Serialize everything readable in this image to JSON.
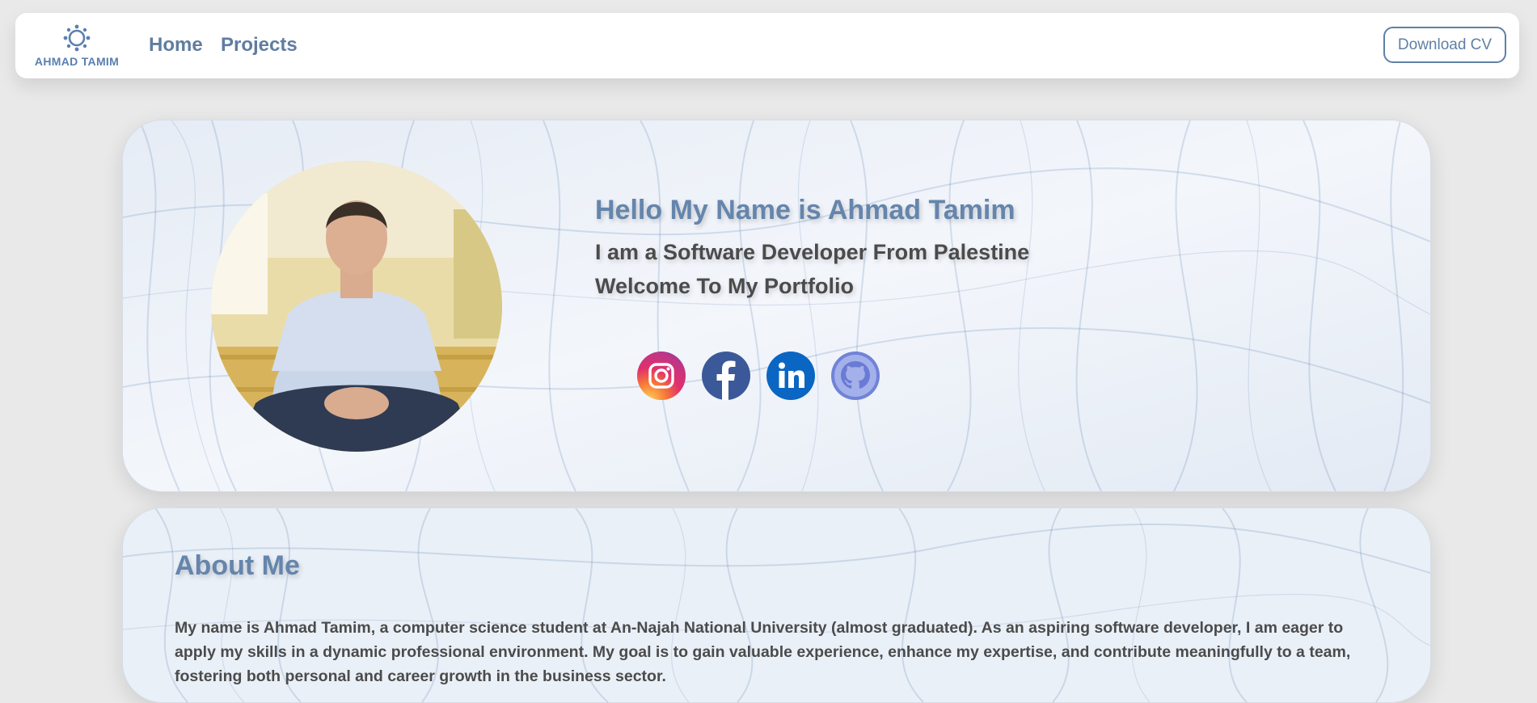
{
  "nav": {
    "logo_text": "AHMAD TAMIM",
    "links": [
      {
        "label": "Home"
      },
      {
        "label": "Projects"
      }
    ],
    "download_label": "Download CV"
  },
  "hero": {
    "title": "Hello My Name is Ahmad Tamim",
    "subtitle_1": "I am a Software Developer From Palestine",
    "subtitle_2": "Welcome To My Portfolio",
    "social": [
      {
        "icon": "instagram-icon"
      },
      {
        "icon": "facebook-icon"
      },
      {
        "icon": "linkedin-icon"
      },
      {
        "icon": "github-icon"
      }
    ]
  },
  "about": {
    "title": "About Me",
    "text": "My name is Ahmad Tamim, a computer science student at An-Najah National University (almost graduated). As an aspiring software developer, I am eager to apply my skills in a dynamic professional environment. My goal is to gain valuable experience, enhance my expertise, and contribute meaningfully to a team, fostering both personal and career growth in the business sector."
  },
  "colors": {
    "accent": "#6585ac",
    "text": "#4b4b4b",
    "background": "#e9e9e9",
    "card": "#eef2f8",
    "instagram": "#e1306c",
    "facebook": "#3b5998",
    "linkedin": "#0a66c2",
    "github": "#6e7fd8"
  }
}
